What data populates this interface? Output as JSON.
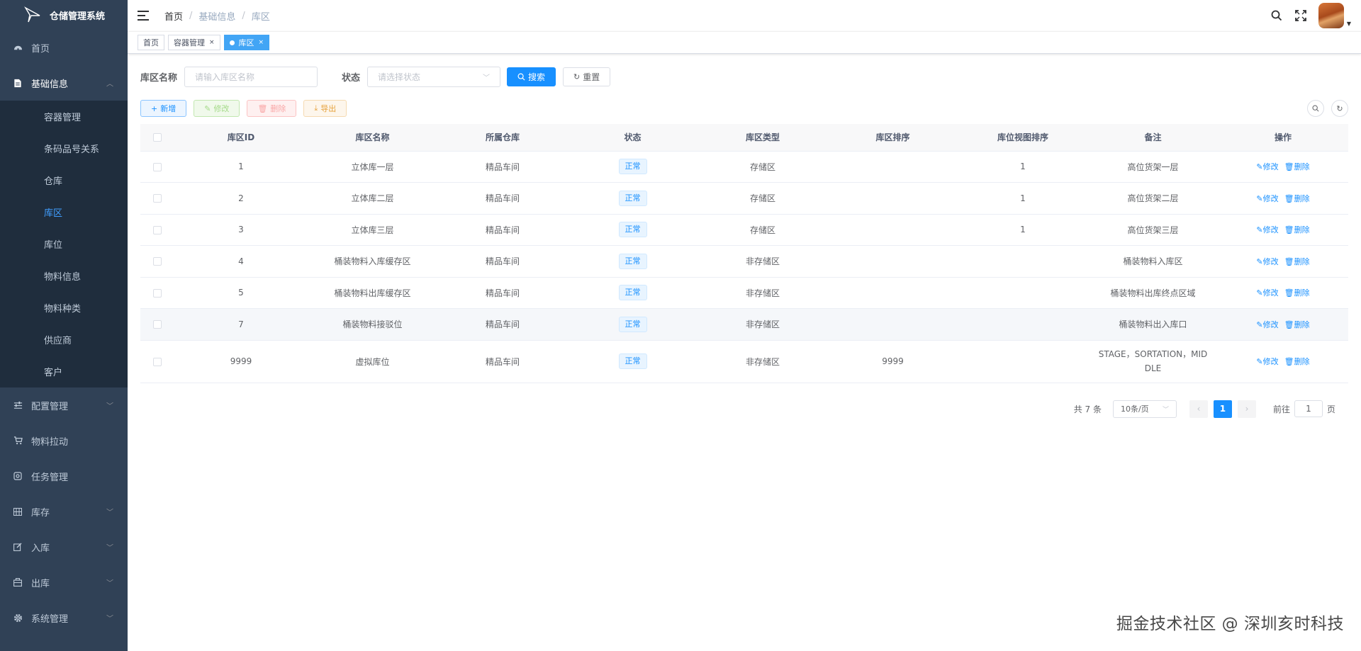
{
  "app": {
    "title": "仓储管理系统"
  },
  "sidebar": {
    "items": [
      {
        "label": "首页",
        "icon": "dashboard-icon",
        "has_children": false
      },
      {
        "label": "基础信息",
        "icon": "document-icon",
        "has_children": true,
        "expanded": true
      },
      {
        "label": "配置管理",
        "icon": "sliders-icon",
        "has_children": true
      },
      {
        "label": "物料拉动",
        "icon": "cart-icon",
        "has_children": false
      },
      {
        "label": "任务管理",
        "icon": "task-icon",
        "has_children": false
      },
      {
        "label": "库存",
        "icon": "grid-icon",
        "has_children": true
      },
      {
        "label": "入库",
        "icon": "edit-icon",
        "has_children": true
      },
      {
        "label": "出库",
        "icon": "box-icon",
        "has_children": true
      },
      {
        "label": "系统管理",
        "icon": "gear-icon",
        "has_children": true
      }
    ],
    "sub_items": [
      "容器管理",
      "条码品号关系",
      "仓库",
      "库区",
      "库位",
      "物料信息",
      "物料种类",
      "供应商",
      "客户"
    ],
    "active_sub": "库区"
  },
  "breadcrumb": [
    "首页",
    "基础信息",
    "库区"
  ],
  "tags": [
    {
      "label": "首页",
      "active": false,
      "closable": false
    },
    {
      "label": "容器管理",
      "active": false,
      "closable": true
    },
    {
      "label": "库区",
      "active": true,
      "closable": true
    }
  ],
  "search": {
    "name_label": "库区名称",
    "name_placeholder": "请输入库区名称",
    "status_label": "状态",
    "status_placeholder": "请选择状态",
    "search_btn": "搜索",
    "reset_btn": "重置"
  },
  "toolbar": {
    "add": "新增",
    "edit": "修改",
    "delete": "删除",
    "export": "导出"
  },
  "table": {
    "columns": [
      "库区ID",
      "库区名称",
      "所属仓库",
      "状态",
      "库区类型",
      "库区排序",
      "库位视图排序",
      "备注",
      "操作"
    ],
    "rows": [
      {
        "id": "1",
        "name": "立体库一层",
        "warehouse": "精品车间",
        "status": "正常",
        "type": "存储区",
        "sort": "",
        "view_sort": "1",
        "remark": "高位货架一层"
      },
      {
        "id": "2",
        "name": "立体库二层",
        "warehouse": "精品车间",
        "status": "正常",
        "type": "存储区",
        "sort": "",
        "view_sort": "1",
        "remark": "高位货架二层"
      },
      {
        "id": "3",
        "name": "立体库三层",
        "warehouse": "精品车间",
        "status": "正常",
        "type": "存储区",
        "sort": "",
        "view_sort": "1",
        "remark": "高位货架三层"
      },
      {
        "id": "4",
        "name": "桶装物料入库缓存区",
        "warehouse": "精品车间",
        "status": "正常",
        "type": "非存储区",
        "sort": "",
        "view_sort": "",
        "remark": "桶装物料入库区"
      },
      {
        "id": "5",
        "name": "桶装物料出库缓存区",
        "warehouse": "精品车间",
        "status": "正常",
        "type": "非存储区",
        "sort": "",
        "view_sort": "",
        "remark": "桶装物料出库终点区域"
      },
      {
        "id": "7",
        "name": "桶装物料接驳位",
        "warehouse": "精品车间",
        "status": "正常",
        "type": "非存储区",
        "sort": "",
        "view_sort": "",
        "remark": "桶装物料出入库口"
      },
      {
        "id": "9999",
        "name": "虚拟库位",
        "warehouse": "精品车间",
        "status": "正常",
        "type": "非存储区",
        "sort": "9999",
        "view_sort": "",
        "remark": "STAGE，SORTATION，MIDDLE",
        "remark_line1": "STAGE，SORTATION，MID",
        "remark_line2": "DLE"
      }
    ],
    "op_edit": "修改",
    "op_delete": "删除"
  },
  "pagination": {
    "total": "共 7 条",
    "page_size": "10条/页",
    "current": "1",
    "goto_label": "前往",
    "goto_value": "1",
    "page_suffix": "页"
  },
  "watermark": "掘金技术社区 @ 深圳亥时科技",
  "colors": {
    "primary": "#1890ff",
    "sidebar": "#304156",
    "submenu": "#1f2d3d"
  }
}
